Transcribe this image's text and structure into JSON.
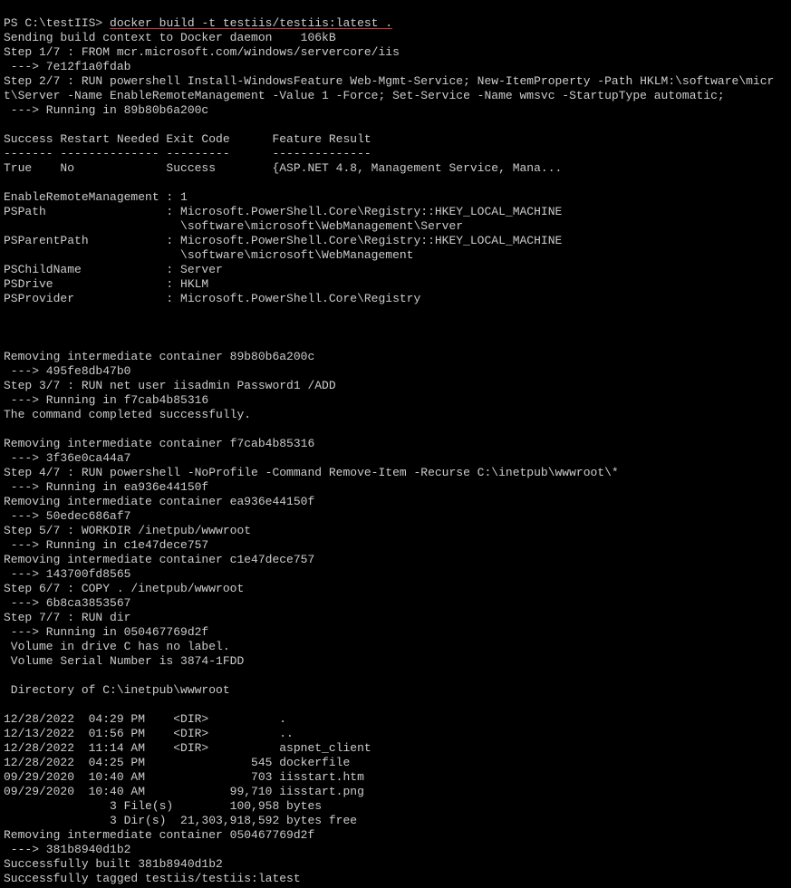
{
  "terminal": {
    "prompt": "PS C:\\testIIS> ",
    "command": "docker build -t testiis/testiis:latest .",
    "lines": [
      "Sending build context to Docker daemon    106kB",
      "Step 1/7 : FROM mcr.microsoft.com/windows/servercore/iis",
      " ---> 7e12f1a0fdab",
      "Step 2/7 : RUN powershell Install-WindowsFeature Web-Mgmt-Service; New-ItemProperty -Path HKLM:\\software\\micr",
      "t\\Server -Name EnableRemoteManagement -Value 1 -Force; Set-Service -Name wmsvc -StartupType automatic;",
      " ---> Running in 89b80b6a200c",
      "",
      "Success Restart Needed Exit Code      Feature Result",
      "------- -------------- ---------      --------------",
      "True    No             Success        {ASP.NET 4.8, Management Service, Mana...",
      "",
      "EnableRemoteManagement : 1",
      "PSPath                 : Microsoft.PowerShell.Core\\Registry::HKEY_LOCAL_MACHINE",
      "                         \\software\\microsoft\\WebManagement\\Server",
      "PSParentPath           : Microsoft.PowerShell.Core\\Registry::HKEY_LOCAL_MACHINE",
      "                         \\software\\microsoft\\WebManagement",
      "PSChildName            : Server",
      "PSDrive                : HKLM",
      "PSProvider             : Microsoft.PowerShell.Core\\Registry",
      "",
      "",
      "",
      "Removing intermediate container 89b80b6a200c",
      " ---> 495fe8db47b0",
      "Step 3/7 : RUN net user iisadmin Password1 /ADD",
      " ---> Running in f7cab4b85316",
      "The command completed successfully.",
      "",
      "Removing intermediate container f7cab4b85316",
      " ---> 3f36e0ca44a7",
      "Step 4/7 : RUN powershell -NoProfile -Command Remove-Item -Recurse C:\\inetpub\\wwwroot\\*",
      " ---> Running in ea936e44150f",
      "Removing intermediate container ea936e44150f",
      " ---> 50edec686af7",
      "Step 5/7 : WORKDIR /inetpub/wwwroot",
      " ---> Running in c1e47dece757",
      "Removing intermediate container c1e47dece757",
      " ---> 143700fd8565",
      "Step 6/7 : COPY . /inetpub/wwwroot",
      " ---> 6b8ca3853567",
      "Step 7/7 : RUN dir",
      " ---> Running in 050467769d2f",
      " Volume in drive C has no label.",
      " Volume Serial Number is 3874-1FDD",
      "",
      " Directory of C:\\inetpub\\wwwroot",
      "",
      "12/28/2022  04:29 PM    <DIR>          .",
      "12/13/2022  01:56 PM    <DIR>          ..",
      "12/28/2022  11:14 AM    <DIR>          aspnet_client",
      "12/28/2022  04:25 PM               545 dockerfile",
      "09/29/2020  10:40 AM               703 iisstart.htm",
      "09/29/2020  10:40 AM            99,710 iisstart.png",
      "               3 File(s)        100,958 bytes",
      "               3 Dir(s)  21,303,918,592 bytes free",
      "Removing intermediate container 050467769d2f",
      " ---> 381b8940d1b2",
      "Successfully built 381b8940d1b2",
      "Successfully tagged testiis/testiis:latest"
    ]
  }
}
